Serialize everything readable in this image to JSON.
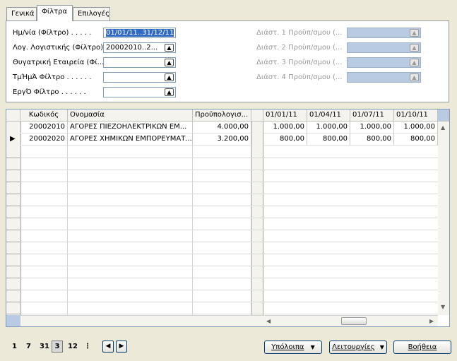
{
  "tabs": [
    {
      "label": "Γενικά",
      "active": false
    },
    {
      "label": "Φίλτρα",
      "active": true
    },
    {
      "label": "Επιλογές",
      "active": false
    }
  ],
  "filters": {
    "date_label": "Ημ/νία (Φίλτρο) . . . . .",
    "date_value": "01/01/11..31/12/11",
    "account_label": "Λογ. Λογιστικής (Φίλτρο)",
    "account_value": "20002010..2...",
    "subsidiary_label": "Θυγατρική Εταιρεία (Φί...",
    "subsidiary_value": "",
    "department_label": "ΤμΉμΆ Φίλτρο . . . . . .",
    "department_value": "",
    "project_label": "ΕργΌ Φίλτρο . . . . . .",
    "project_value": "",
    "dim1_label": "Διάστ. 1 Προϋπ/σμου (...",
    "dim2_label": "Διάστ. 2 Προϋπ/σμου (...",
    "dim3_label": "Διάστ. 3 Προϋπ/σμου (...",
    "dim4_label": "Διάστ. 4 Προϋπ/σμου (..."
  },
  "grid": {
    "headers": {
      "code": "Κωδικός",
      "name": "Ονομασία",
      "budget": "Προϋπολογισ..."
    },
    "period_headers": [
      "01/01/11",
      "01/04/11",
      "01/07/11",
      "01/10/11"
    ],
    "rows": [
      {
        "code": "20002010",
        "name": "ΑΓΟΡΕΣ ΠΙΕΖΟΗΛΕΚΤΡΙΚΩΝ ΕΜ...",
        "budget": "4.000,00",
        "periods": [
          "1.000,00",
          "1.000,00",
          "1.000,00",
          "1.000,00"
        ]
      },
      {
        "code": "20002020",
        "name": "ΑΓΟΡΕΣ ΧΗΜΙΚΩΝ ΕΜΠΟΡΕΥΜΑΤ...",
        "budget": "3.200,00",
        "periods": [
          "800,00",
          "800,00",
          "800,00",
          "800,00"
        ]
      }
    ],
    "current_row_indicator": "▶"
  },
  "pager": {
    "day": "1",
    "week": "7",
    "month": "31",
    "quarter": "3",
    "year": "12",
    "period": "⋮",
    "prev": "◀",
    "next": "▶"
  },
  "buttons": {
    "balances": "Υπόλοιπα",
    "functions": "Λειτουργίες",
    "help": "Βοήθεια"
  },
  "icons": {
    "lookup": "▲",
    "dropdown": "▼",
    "scroll_up": "▲",
    "scroll_down": "▼",
    "scroll_left": "◀",
    "scroll_right": "▶"
  },
  "colors": {
    "selection": "#316ac5",
    "disabled_field": "#b8cbe3",
    "window_bg": "#ece9d8"
  }
}
